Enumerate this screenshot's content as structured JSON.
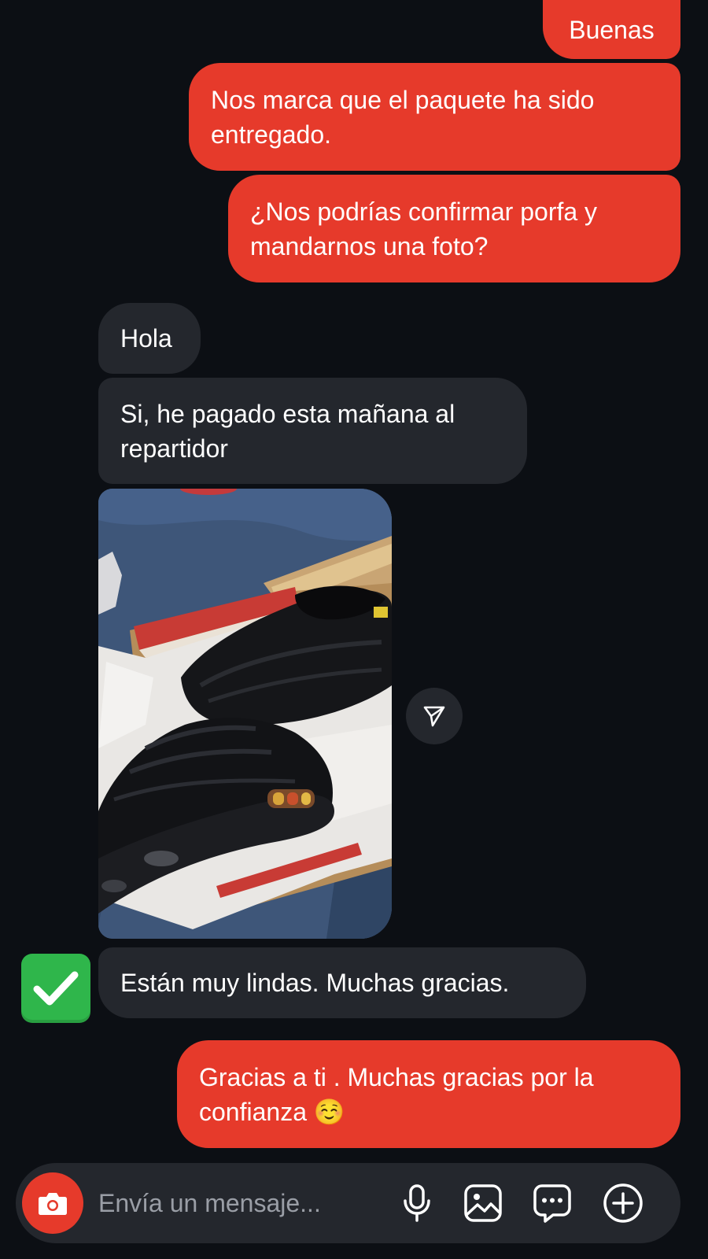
{
  "chat": {
    "messages": [
      {
        "from": "me",
        "text": "Buenas"
      },
      {
        "from": "me",
        "text": "Nos marca que el paquete ha sido\nentregado."
      },
      {
        "from": "me",
        "text": "¿Nos podrías confirmar porfa y\nmandarnos una foto?"
      },
      {
        "from": "them",
        "text": "Hola"
      },
      {
        "from": "them",
        "text": "Si, he pagado esta mañana al\nrepartidor"
      },
      {
        "from": "them",
        "type": "photo",
        "icon": "shoe-photo"
      },
      {
        "from": "them",
        "text": "Están muy lindas. Muchas gracias.",
        "reaction": "✅"
      },
      {
        "from": "me",
        "text": "Gracias a ti . Muchas gracias por la\nconfianza ☺️"
      }
    ],
    "share_icon": "send-arrow-icon"
  },
  "composer": {
    "placeholder": "Envía un mensaje...",
    "icons": [
      "camera-icon",
      "microphone-icon",
      "gallery-icon",
      "sticker-chat-icon",
      "plus-circle-icon"
    ]
  },
  "colors": {
    "background": "#0c0f14",
    "sent_bubble": "#e63a2b",
    "received_bubble": "#24272d",
    "reaction_check": "#2fb64b"
  }
}
